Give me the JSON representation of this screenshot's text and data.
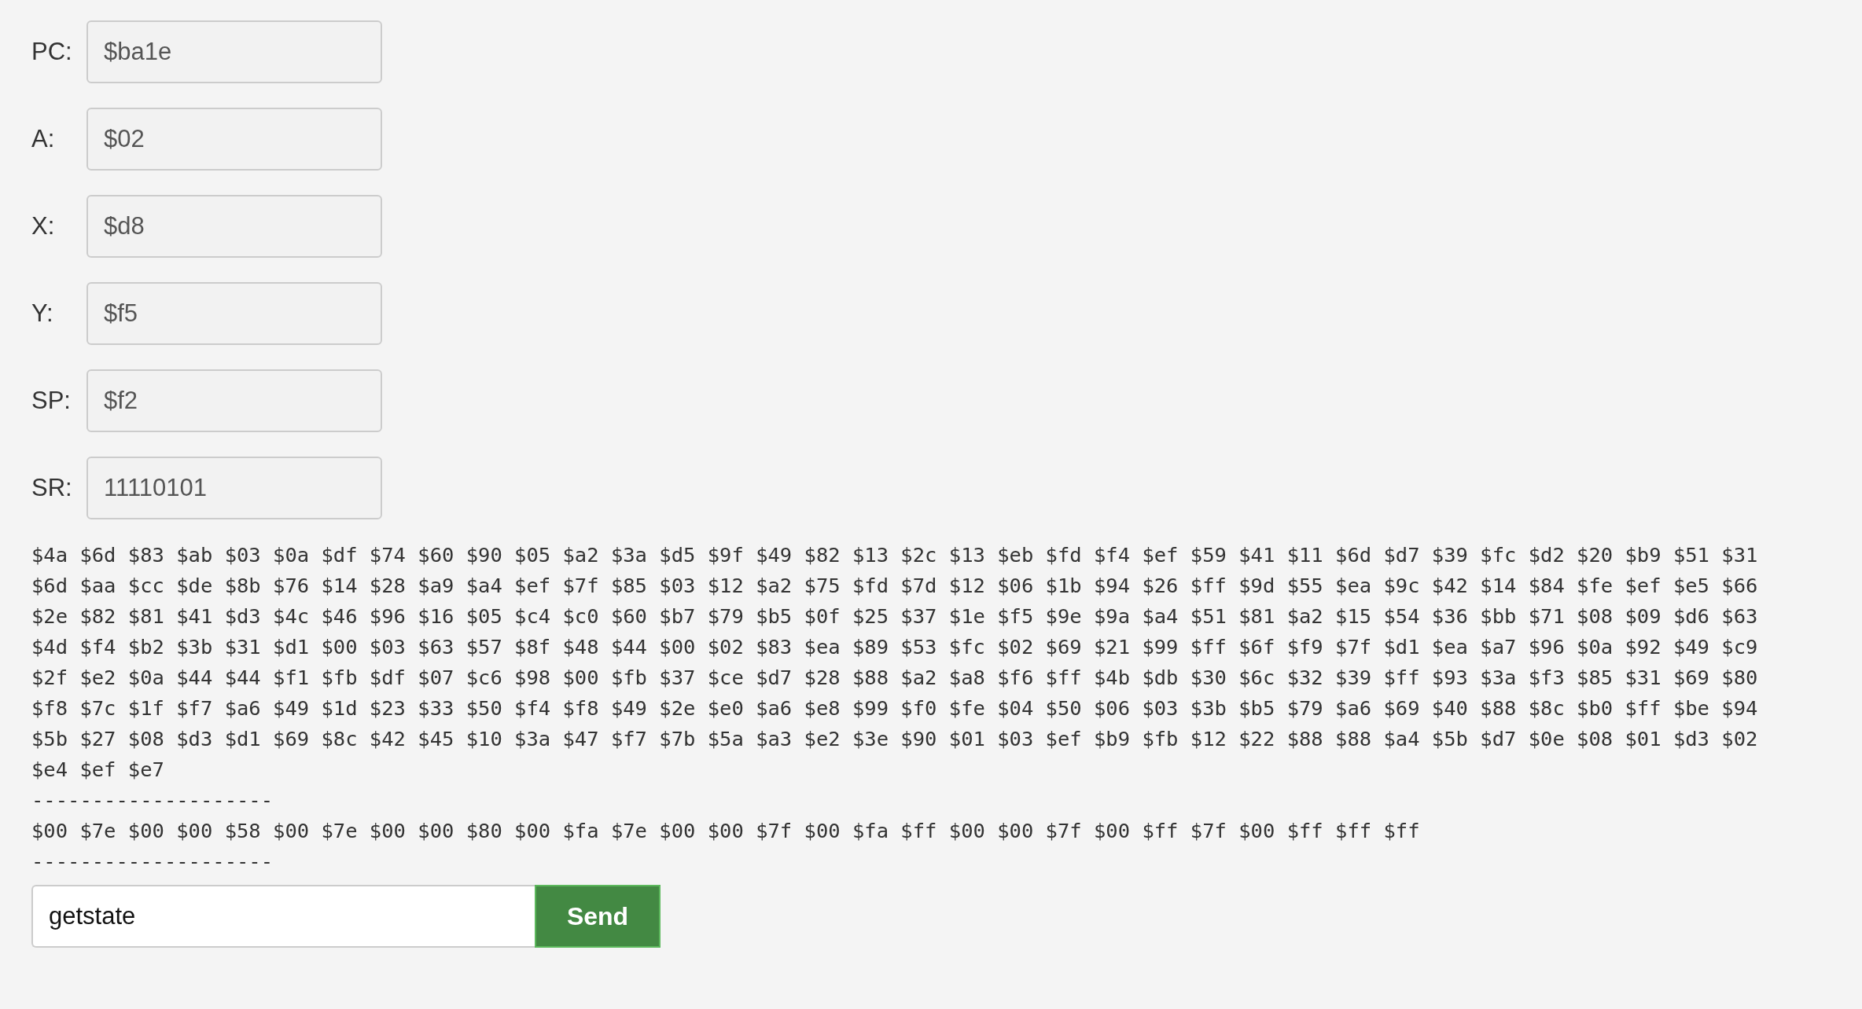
{
  "registers": [
    {
      "label": "PC:",
      "value": "$ba1e"
    },
    {
      "label": "A:",
      "value": "$02"
    },
    {
      "label": "X:",
      "value": "$d8"
    },
    {
      "label": "Y:",
      "value": "$f5"
    },
    {
      "label": "SP:",
      "value": "$f2"
    },
    {
      "label": "SR:",
      "value": "11110101"
    }
  ],
  "output_lines": [
    "$4a $6d $83 $ab $03 $0a $df $74 $60 $90 $05 $a2 $3a $d5 $9f $49 $82 $13 $2c $13 $eb $fd $f4 $ef $59 $41 $11 $6d $d7 $39 $fc $d2 $20 $b9 $51 $31",
    "$6d $aa $cc $de $8b $76 $14 $28 $a9 $a4 $ef $7f $85 $03 $12 $a2 $75 $fd $7d $12 $06 $1b $94 $26 $ff $9d $55 $ea $9c $42 $14 $84 $fe $ef $e5 $66",
    "$2e $82 $81 $41 $d3 $4c $46 $96 $16 $05 $c4 $c0 $60 $b7 $79 $b5 $0f $25 $37 $1e $f5 $9e $9a $a4 $51 $81 $a2 $15 $54 $36 $bb $71 $08 $09 $d6 $63",
    "$4d $f4 $b2 $3b $31 $d1 $00 $03 $63 $57 $8f $48 $44 $00 $02 $83 $ea $89 $53 $fc $02 $69 $21 $99 $ff $6f $f9 $7f $d1 $ea $a7 $96 $0a $92 $49 $c9",
    "$2f $e2 $0a $44 $44 $f1 $fb $df $07 $c6 $98 $00 $fb $37 $ce $d7 $28 $88 $a2 $a8 $f6 $ff $4b $db $30 $6c $32 $39 $ff $93 $3a $f3 $85 $31 $69 $80",
    "$f8 $7c $1f $f7 $a6 $49 $1d $23 $33 $50 $f4 $f8 $49 $2e $e0 $a6 $e8 $99 $f0 $fe $04 $50 $06 $03 $3b $b5 $79 $a6 $69 $40 $88 $8c $b0 $ff $be $94",
    "$5b $27 $08 $d3 $d1 $69 $8c $42 $45 $10 $3a $47 $f7 $7b $5a $a3 $e2 $3e $90 $01 $03 $ef $b9 $fb $12 $22 $88 $88 $a4 $5b $d7 $0e $08 $01 $d3 $02",
    "$e4 $ef $e7",
    "--------------------",
    "$00 $7e $00 $00 $58 $00 $7e $00 $00 $80 $00 $fa $7e $00 $00 $7f $00 $fa $ff $00 $00 $7f $00 $ff $7f $00 $ff $ff $ff",
    "--------------------"
  ],
  "command": {
    "value": "getstate",
    "button": "Send"
  }
}
